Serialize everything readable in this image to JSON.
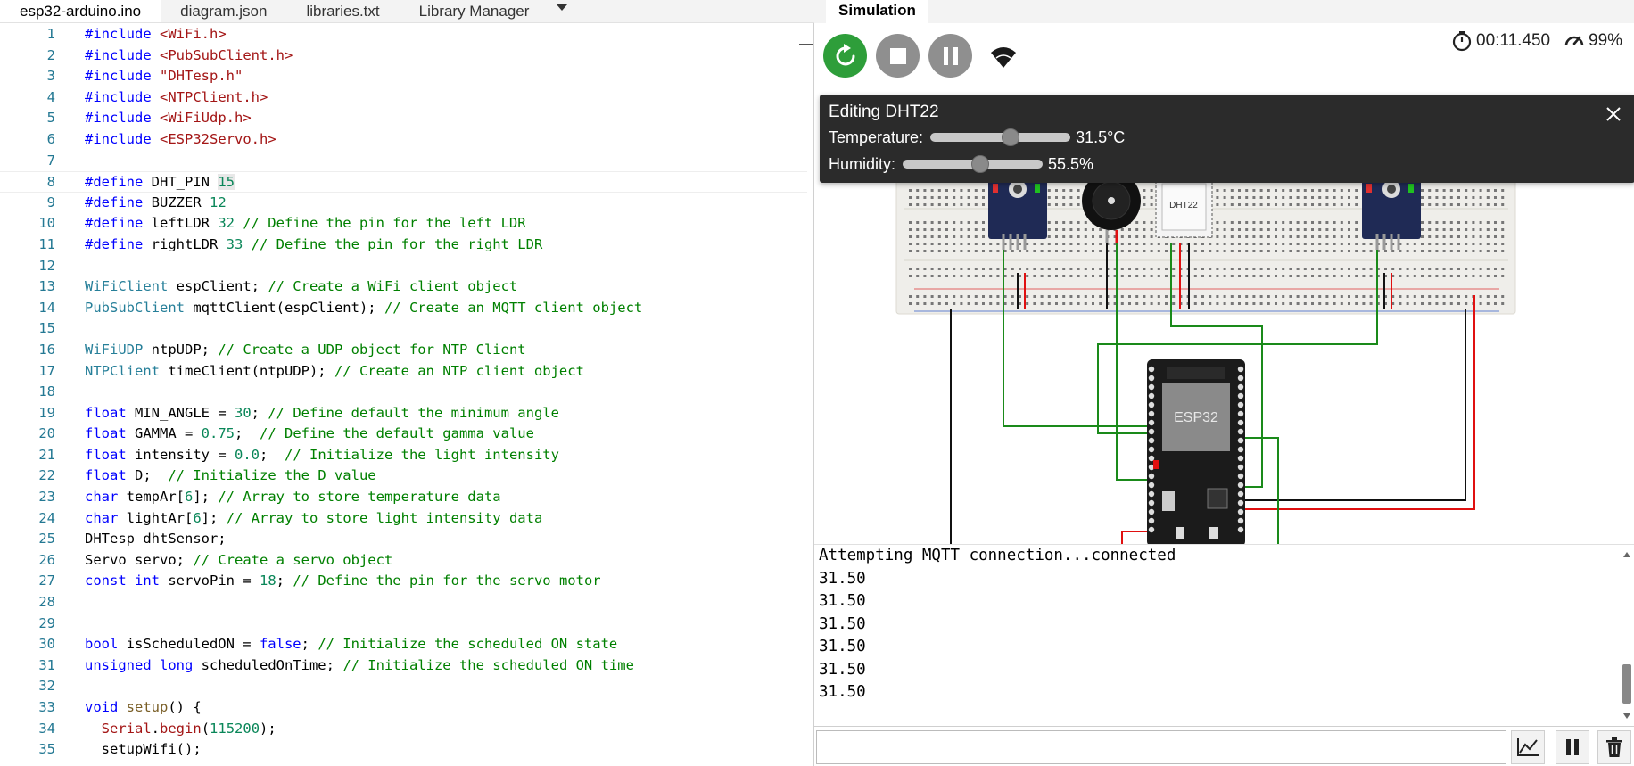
{
  "editor": {
    "tabs": [
      {
        "label": "esp32-arduino.ino"
      },
      {
        "label": "diagram.json"
      },
      {
        "label": "libraries.txt"
      },
      {
        "label": "Library Manager"
      }
    ],
    "lines": [
      {
        "n": "1",
        "parts": [
          [
            "mac",
            "#include "
          ],
          [
            "str",
            "<WiFi.h>"
          ]
        ]
      },
      {
        "n": "2",
        "parts": [
          [
            "mac",
            "#include "
          ],
          [
            "str",
            "<PubSubClient.h>"
          ]
        ]
      },
      {
        "n": "3",
        "parts": [
          [
            "mac",
            "#include "
          ],
          [
            "str",
            "\"DHTesp.h\""
          ]
        ]
      },
      {
        "n": "4",
        "parts": [
          [
            "mac",
            "#include "
          ],
          [
            "str",
            "<NTPClient.h>"
          ]
        ]
      },
      {
        "n": "5",
        "parts": [
          [
            "mac",
            "#include "
          ],
          [
            "str",
            "<WiFiUdp.h>"
          ]
        ]
      },
      {
        "n": "6",
        "parts": [
          [
            "mac",
            "#include "
          ],
          [
            "str",
            "<ESP32Servo.h>"
          ]
        ]
      },
      {
        "n": "7",
        "parts": []
      },
      {
        "n": "8",
        "parts": [
          [
            "mac",
            "#define "
          ],
          [
            "txt",
            "DHT_PIN "
          ],
          [
            "hlnum",
            "15"
          ]
        ]
      },
      {
        "n": "9",
        "parts": [
          [
            "mac",
            "#define "
          ],
          [
            "txt",
            "BUZZER "
          ],
          [
            "num",
            "12"
          ]
        ]
      },
      {
        "n": "10",
        "parts": [
          [
            "mac",
            "#define "
          ],
          [
            "txt",
            "leftLDR "
          ],
          [
            "num",
            "32"
          ],
          [
            "com",
            " // Define the pin for the left LDR"
          ]
        ]
      },
      {
        "n": "11",
        "parts": [
          [
            "mac",
            "#define "
          ],
          [
            "txt",
            "rightLDR "
          ],
          [
            "num",
            "33"
          ],
          [
            "com",
            " // Define the pin for the right LDR"
          ]
        ]
      },
      {
        "n": "12",
        "parts": []
      },
      {
        "n": "13",
        "parts": [
          [
            "ty",
            "WiFiClient"
          ],
          [
            "txt",
            " espClient; "
          ],
          [
            "com",
            "// Create a WiFi client object"
          ]
        ]
      },
      {
        "n": "14",
        "parts": [
          [
            "ty",
            "PubSubClient"
          ],
          [
            "txt",
            " mqttClient(espClient); "
          ],
          [
            "com",
            "// Create an MQTT client object"
          ]
        ]
      },
      {
        "n": "15",
        "parts": []
      },
      {
        "n": "16",
        "parts": [
          [
            "ty",
            "WiFiUDP"
          ],
          [
            "txt",
            " ntpUDP; "
          ],
          [
            "com",
            "// Create a UDP object for NTP Client"
          ]
        ]
      },
      {
        "n": "17",
        "parts": [
          [
            "ty",
            "NTPClient"
          ],
          [
            "txt",
            " timeClient(ntpUDP); "
          ],
          [
            "com",
            "// Create an NTP client object"
          ]
        ]
      },
      {
        "n": "18",
        "parts": []
      },
      {
        "n": "19",
        "parts": [
          [
            "kw",
            "float"
          ],
          [
            "txt",
            " MIN_ANGLE = "
          ],
          [
            "num",
            "30"
          ],
          [
            "txt",
            "; "
          ],
          [
            "com",
            "// Define default the minimum angle"
          ]
        ]
      },
      {
        "n": "20",
        "parts": [
          [
            "kw",
            "float"
          ],
          [
            "txt",
            " GAMMA = "
          ],
          [
            "num",
            "0.75"
          ],
          [
            "txt",
            ";  "
          ],
          [
            "com",
            "// Define the default gamma value"
          ]
        ]
      },
      {
        "n": "21",
        "parts": [
          [
            "kw",
            "float"
          ],
          [
            "txt",
            " intensity = "
          ],
          [
            "num",
            "0.0"
          ],
          [
            "txt",
            ";  "
          ],
          [
            "com",
            "// Initialize the light intensity"
          ]
        ]
      },
      {
        "n": "22",
        "parts": [
          [
            "kw",
            "float"
          ],
          [
            "txt",
            " D;  "
          ],
          [
            "com",
            "// Initialize the D value"
          ]
        ]
      },
      {
        "n": "23",
        "parts": [
          [
            "kw",
            "char"
          ],
          [
            "txt",
            " tempAr["
          ],
          [
            "num",
            "6"
          ],
          [
            "txt",
            "]; "
          ],
          [
            "com",
            "// Array to store temperature data"
          ]
        ]
      },
      {
        "n": "24",
        "parts": [
          [
            "kw",
            "char"
          ],
          [
            "txt",
            " lightAr["
          ],
          [
            "num",
            "6"
          ],
          [
            "txt",
            "]; "
          ],
          [
            "com",
            "// Array to store light intensity data"
          ]
        ]
      },
      {
        "n": "25",
        "parts": [
          [
            "txt",
            "DHTesp dhtSensor;"
          ]
        ]
      },
      {
        "n": "26",
        "parts": [
          [
            "txt",
            "Servo servo; "
          ],
          [
            "com",
            "// Create a servo object"
          ]
        ]
      },
      {
        "n": "27",
        "parts": [
          [
            "kw",
            "const int"
          ],
          [
            "txt",
            " servoPin = "
          ],
          [
            "num",
            "18"
          ],
          [
            "txt",
            "; "
          ],
          [
            "com",
            "// Define the pin for the servo motor"
          ]
        ]
      },
      {
        "n": "28",
        "parts": []
      },
      {
        "n": "29",
        "parts": []
      },
      {
        "n": "30",
        "parts": [
          [
            "kw",
            "bool"
          ],
          [
            "txt",
            " isScheduledON = "
          ],
          [
            "kw",
            "false"
          ],
          [
            "txt",
            "; "
          ],
          [
            "com",
            "// Initialize the scheduled ON state"
          ]
        ]
      },
      {
        "n": "31",
        "parts": [
          [
            "kw",
            "unsigned long"
          ],
          [
            "txt",
            " scheduledOnTime; "
          ],
          [
            "com",
            "// Initialize the scheduled ON time"
          ]
        ]
      },
      {
        "n": "32",
        "parts": []
      },
      {
        "n": "33",
        "parts": [
          [
            "kw",
            "void"
          ],
          [
            "txt",
            " "
          ],
          [
            "fn",
            "setup"
          ],
          [
            "txt",
            "() {"
          ]
        ]
      },
      {
        "n": "34",
        "parts": [
          [
            "txt",
            "  "
          ],
          [
            "ser",
            "Serial"
          ],
          [
            "txt",
            "."
          ],
          [
            "ser",
            "begin"
          ],
          [
            "txt",
            "("
          ],
          [
            "num",
            "115200"
          ],
          [
            "txt",
            ");"
          ]
        ]
      },
      {
        "n": "35",
        "parts": [
          [
            "txt",
            "  setupWifi();"
          ]
        ]
      }
    ]
  },
  "simulation": {
    "tab_label": "Simulation",
    "timer": "00:11.450",
    "speed": "99%",
    "dht_editor": {
      "title": "Editing DHT22",
      "temperature_label": "Temperature:",
      "temperature_value": "31.5°C",
      "temperature_fraction": 0.57,
      "humidity_label": "Humidity:",
      "humidity_value": "55.5%",
      "humidity_fraction": 0.555
    },
    "board_labels": {
      "esp32": "ESP32",
      "dht22": "DHT22"
    },
    "serial_output": [
      "Attempting MQTT connection...connected",
      "31.50",
      "31.50",
      "31.50",
      "31.50",
      "31.50",
      "31.50"
    ]
  },
  "colors": {
    "run_green": "#2e9e3a",
    "control_gray": "#8f8f8f",
    "popover_bg": "#2b2b2b",
    "wire_green": "#1a8a1a",
    "wire_red": "#e01010",
    "wire_black": "#111111"
  }
}
